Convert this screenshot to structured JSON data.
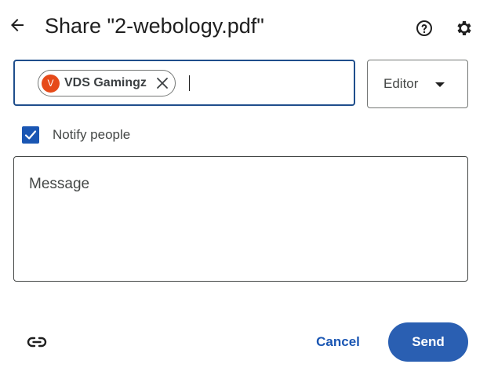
{
  "header": {
    "title": "Share \"2-webology.pdf\"",
    "back_icon": "arrow-left-icon",
    "help_icon": "help-circle-icon",
    "settings_icon": "gear-icon"
  },
  "recipients": {
    "chips": [
      {
        "initial": "V",
        "name": "VDS Gamingz",
        "avatar_color": "#e64a19",
        "remove_icon": "close-icon"
      }
    ],
    "input_value": ""
  },
  "role": {
    "selected": "Editor",
    "caret_icon": "caret-down-icon"
  },
  "notify": {
    "checked": true,
    "label": "Notify people"
  },
  "message": {
    "placeholder": "Message",
    "value": ""
  },
  "footer": {
    "link_icon": "link-icon",
    "cancel_label": "Cancel",
    "send_label": "Send"
  },
  "colors": {
    "accent": "#1a56b3",
    "send_button": "#2a5fb2",
    "input_focus_border": "#1f4e8c"
  }
}
